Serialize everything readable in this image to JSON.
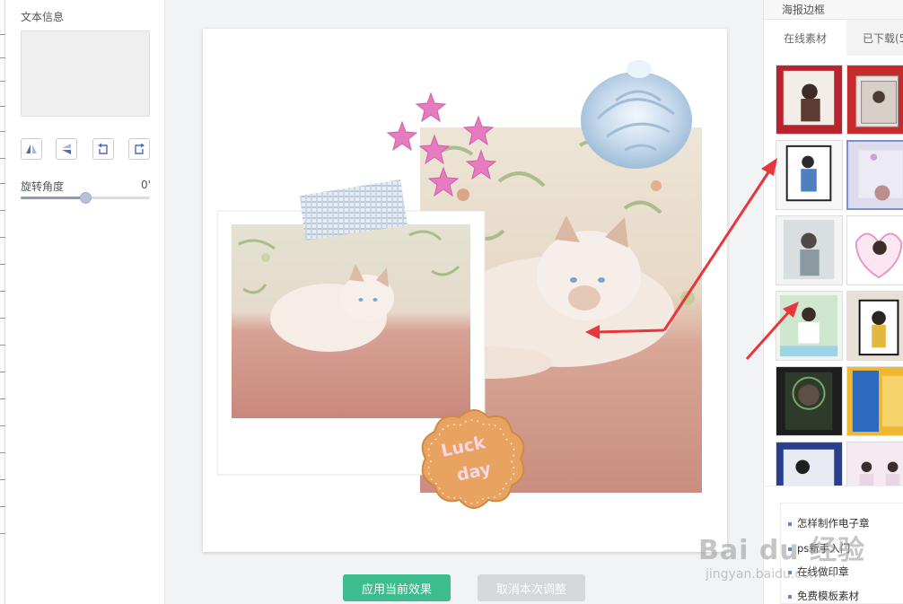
{
  "left_panel": {
    "text_info_label": "文本信息",
    "rotation_label": "旋转角度",
    "rotation_value": "0'",
    "rotation_level": 0.5,
    "tools": [
      "flip-horizontal-icon",
      "flip-vertical-icon",
      "rotate-left-icon",
      "rotate-right-icon"
    ]
  },
  "canvas": {
    "stickers": [
      "pink-star-icon",
      "whipped-cream-icon",
      "washi-tape-icon"
    ],
    "cookie_text": "Luck\nday"
  },
  "footer": {
    "apply_label": "应用当前效果",
    "cancel_label": "取消本次调整"
  },
  "right_panel": {
    "title": "海报边框",
    "tabs": [
      "在线素材",
      "已下载(5"
    ],
    "active_tab": "在线素材",
    "links": [
      "怎样制作电子章",
      "ps新手入门",
      "在线做印章",
      "免费模板素材"
    ]
  },
  "watermark": {
    "main": "Bai du 经验",
    "sub": "jingyan.baidu.com"
  },
  "colors": {
    "accent": "#3dbd8d",
    "selected_border": "#7c8ed6",
    "arrow": "#e8363b"
  }
}
